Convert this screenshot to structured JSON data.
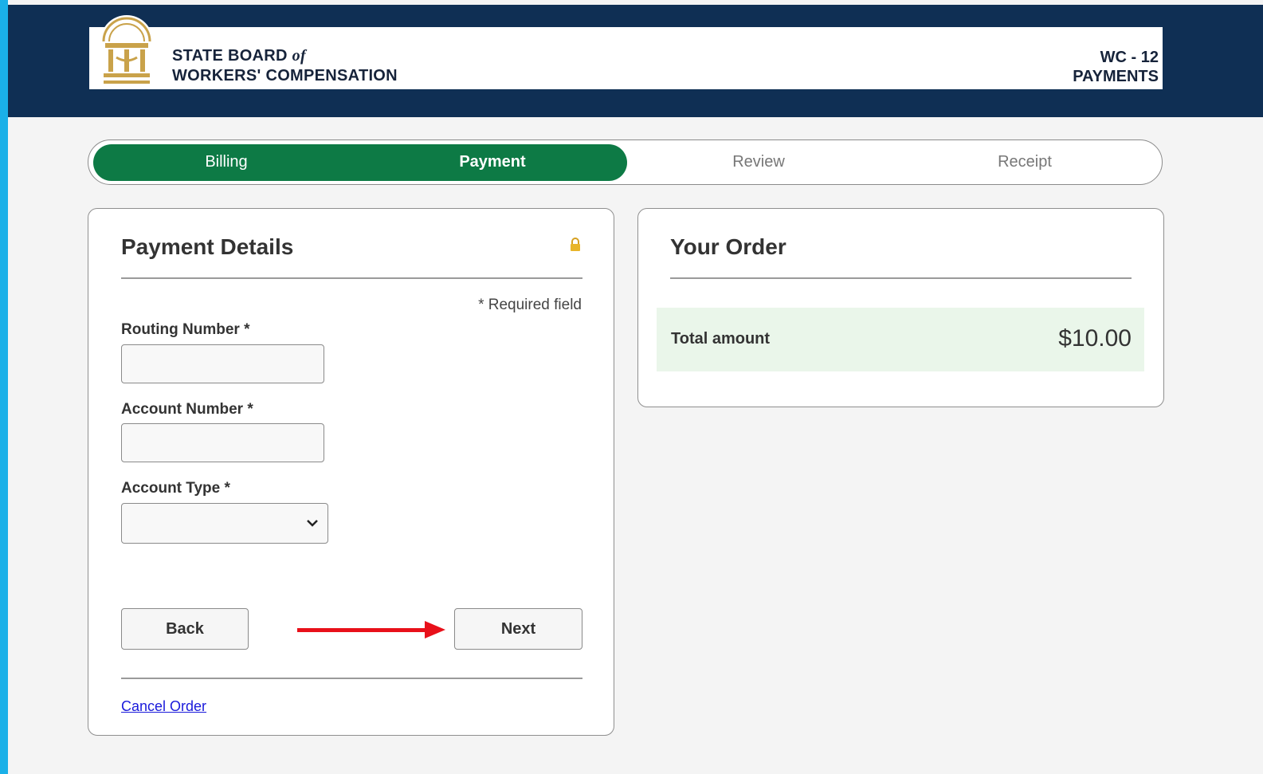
{
  "header": {
    "org_line1_a": "STATE BOARD ",
    "org_line1_of": "of",
    "org_line2": "WORKERS' COMPENSATION",
    "form_code": "WC - 12",
    "form_title": "PAYMENTS",
    "seal_icon": "georgia-state-seal-icon"
  },
  "steps": [
    {
      "label": "Billing",
      "state": "complete"
    },
    {
      "label": "Payment",
      "state": "active"
    },
    {
      "label": "Review",
      "state": "upcoming"
    },
    {
      "label": "Receipt",
      "state": "upcoming"
    }
  ],
  "payment": {
    "title": "Payment Details",
    "lock_icon": "lock-icon",
    "required_note": "* Required field",
    "routing_label": "Routing Number *",
    "routing_value": "",
    "account_label": "Account Number *",
    "account_value": "",
    "type_label": "Account Type *",
    "type_value": "",
    "back_label": "Back",
    "next_label": "Next",
    "cancel_label": "Cancel Order"
  },
  "order": {
    "title": "Your Order",
    "total_label": "Total amount",
    "total_value": "$10.00"
  },
  "colors": {
    "header_bg": "#0f2f54",
    "step_active": "#0d7a45",
    "accent_strip": "#1ab0e8",
    "annotation_arrow": "#e8101a"
  }
}
